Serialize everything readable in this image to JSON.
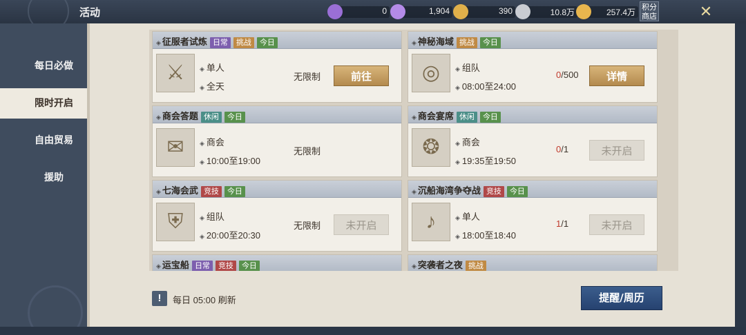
{
  "header": {
    "title": "活动",
    "shop_line1": "积分",
    "shop_line2": "商店",
    "close_icon": "close-x-icon"
  },
  "currencies": [
    {
      "name": "purple-gem-icon",
      "color": "#9a6fd6",
      "value": "0"
    },
    {
      "name": "purple-gem-bound-icon",
      "color": "#b48be8",
      "value": "1,904"
    },
    {
      "name": "gold-coin-icon",
      "color": "#e0b04a",
      "value": "390"
    },
    {
      "name": "silver-coin-icon",
      "color": "#c9ccd2",
      "value": "10.8万"
    },
    {
      "name": "gold-ingot-icon",
      "color": "#e8b64e",
      "value": "257.4万"
    }
  ],
  "sidebar": {
    "items": [
      {
        "label": "每日必做"
      },
      {
        "label": "限时开启"
      },
      {
        "label": "自由贸易"
      },
      {
        "label": "援助"
      }
    ],
    "active_index": 1
  },
  "activities": [
    {
      "name": "征服者试炼",
      "tags": [
        {
          "t": "日常",
          "c": "purple"
        },
        {
          "t": "挑战",
          "c": "orange"
        },
        {
          "t": "今日",
          "c": "green"
        }
      ],
      "icon": "crossed-swords-icon",
      "mode": "单人",
      "time": "全天",
      "limit": "无限制",
      "count": "",
      "count_hl": "",
      "button": "前往",
      "btn_style": "gold"
    },
    {
      "name": "神秘海域",
      "tags": [
        {
          "t": "挑战",
          "c": "orange"
        },
        {
          "t": "今日",
          "c": "green"
        }
      ],
      "icon": "whirlpool-icon",
      "mode": "组队",
      "time": "08:00至24:00",
      "limit": "",
      "count_hl": "0",
      "count": "/500",
      "button": "详情",
      "btn_style": "gold"
    },
    {
      "name": "商会答题",
      "tags": [
        {
          "t": "休闲",
          "c": "teal"
        },
        {
          "t": "今日",
          "c": "green"
        }
      ],
      "icon": "scroll-quill-icon",
      "mode": "商会",
      "time": "10:00至19:00",
      "limit": "无限制",
      "count": "",
      "count_hl": "",
      "button": "",
      "btn_style": "none"
    },
    {
      "name": "商会宴席",
      "tags": [
        {
          "t": "休闲",
          "c": "teal"
        },
        {
          "t": "今日",
          "c": "green"
        }
      ],
      "icon": "roast-meat-icon",
      "mode": "商会",
      "time": "19:35至19:50",
      "limit": "",
      "count_hl": "0",
      "count": "/1",
      "button": "未开启",
      "btn_style": "grey"
    },
    {
      "name": "七海会武",
      "tags": [
        {
          "t": "竞技",
          "c": "red"
        },
        {
          "t": "今日",
          "c": "green"
        }
      ],
      "icon": "emblem-shield-icon",
      "mode": "组队",
      "time": "20:00至20:30",
      "limit": "无限制",
      "count": "",
      "count_hl": "",
      "button": "未开启",
      "btn_style": "grey"
    },
    {
      "name": "沉船海湾争夺战",
      "tags": [
        {
          "t": "竞技",
          "c": "red"
        },
        {
          "t": "今日",
          "c": "green"
        }
      ],
      "icon": "horn-icon",
      "mode": "单人",
      "time": "18:00至18:40",
      "limit": "",
      "count_hl": "1",
      "count": "/1",
      "button": "未开启",
      "btn_style": "grey"
    },
    {
      "name": "运宝船",
      "tags": [
        {
          "t": "日常",
          "c": "purple"
        },
        {
          "t": "竞技",
          "c": "red"
        },
        {
          "t": "今日",
          "c": "green"
        }
      ],
      "icon": "",
      "mode": "",
      "time": "",
      "limit": "",
      "count": "",
      "count_hl": "",
      "button": "",
      "btn_style": "none"
    },
    {
      "name": "突袭者之夜",
      "tags": [
        {
          "t": "挑战",
          "c": "orange"
        }
      ],
      "icon": "",
      "mode": "",
      "time": "",
      "limit": "",
      "count": "",
      "count_hl": "",
      "button": "",
      "btn_style": "none"
    }
  ],
  "footer": {
    "refresh_text": "每日 05:00 刷新",
    "warn_glyph": "!",
    "remind_button": "提醒/周历"
  }
}
